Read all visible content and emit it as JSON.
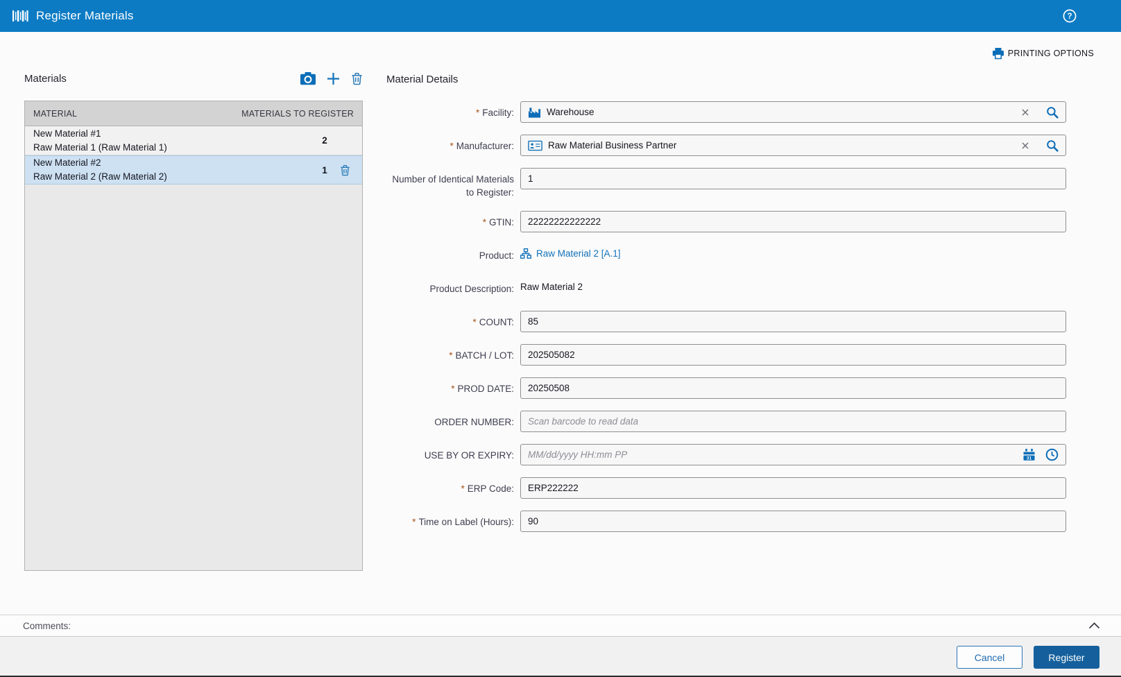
{
  "colors": {
    "header_blue": "#0c7bc4",
    "accent_blue": "#1272b9",
    "icon_blue": "#0d6eb8",
    "register_button_blue": "#15609c",
    "selected_row_blue": "#cde1f2",
    "required_marker_color": "#a8531b",
    "field_background": "#f7f7f7"
  },
  "header": {
    "title": "Register Materials"
  },
  "printing_options": {
    "label": "PRINTING OPTIONS"
  },
  "materials_panel": {
    "title": "Materials",
    "columns": {
      "material": "MATERIAL",
      "to_register": "MATERIALS TO REGISTER"
    },
    "rows": [
      {
        "name": "New Material #1",
        "description": "Raw Material 1 (Raw Material 1)",
        "count": "2"
      },
      {
        "name": "New Material #2",
        "description": "Raw Material 2 (Raw Material 2)",
        "count": "1"
      }
    ]
  },
  "details": {
    "title": "Material Details",
    "required_marker": "*",
    "fields": {
      "facility": {
        "label": "Facility:",
        "value": "Warehouse"
      },
      "manufacturer": {
        "label": "Manufacturer:",
        "value": "Raw Material Business Partner"
      },
      "identical_count": {
        "label": "Number of Identical Materials to Register:",
        "value": "1"
      },
      "gtin": {
        "label": "GTIN:",
        "value": "22222222222222"
      },
      "product": {
        "label": "Product:",
        "link": "Raw Material 2 [A.1]"
      },
      "product_description": {
        "label": "Product Description:",
        "value": "Raw Material 2"
      },
      "count": {
        "label": "COUNT:",
        "value": "85"
      },
      "batch_lot": {
        "label": "BATCH / LOT:",
        "value": "202505082"
      },
      "prod_date": {
        "label": "PROD DATE:",
        "value": "20250508"
      },
      "order_number": {
        "label": "ORDER NUMBER:",
        "placeholder": "Scan barcode to read data"
      },
      "use_by": {
        "label": "USE BY OR EXPIRY:",
        "placeholder": "MM/dd/yyyy HH:mm PP",
        "calendar_day": "31"
      },
      "erp_code": {
        "label": "ERP Code:",
        "value": "ERP222222"
      },
      "time_on_label": {
        "label": "Time on Label (Hours):",
        "value": "90"
      }
    }
  },
  "comments": {
    "label": "Comments:"
  },
  "footer": {
    "cancel_label": "Cancel",
    "register_label": "Register"
  }
}
